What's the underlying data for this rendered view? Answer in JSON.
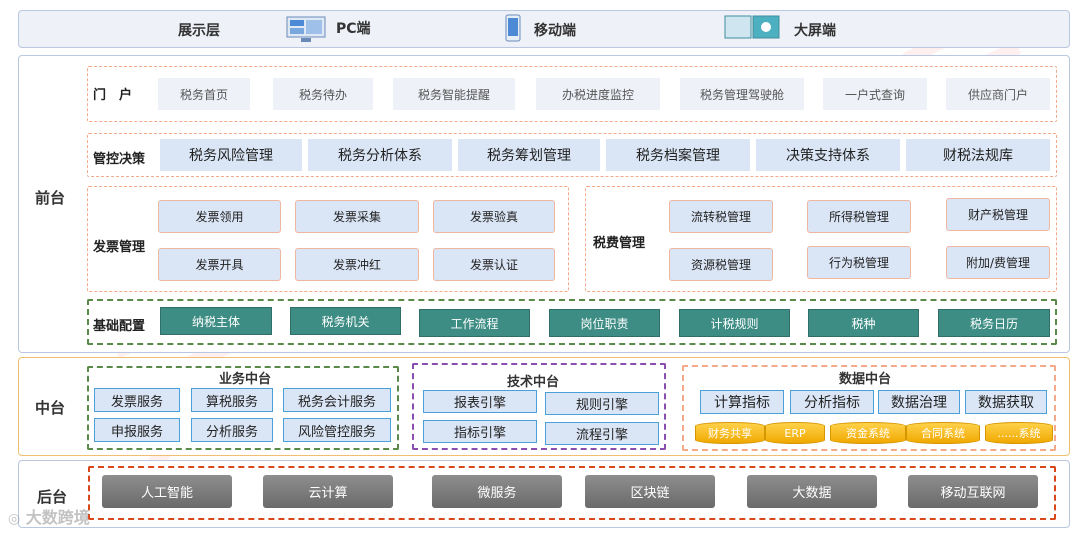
{
  "display_layer": {
    "label": "展示层",
    "items": [
      {
        "label": "PC端",
        "icon": "monitor-icon"
      },
      {
        "label": "移动端",
        "icon": "mobile-phone-icon"
      },
      {
        "label": "大屏端",
        "icon": "large-screen-icon"
      }
    ]
  },
  "front": {
    "label": "前台",
    "portal": {
      "label": "门　户",
      "items": [
        "税务首页",
        "税务待办",
        "税务智能提醒",
        "办税进度监控",
        "税务管理驾驶舱",
        "一户式查询",
        "供应商门户"
      ]
    },
    "control": {
      "label": "管控决策",
      "items": [
        "税务风险管理",
        "税务分析体系",
        "税务筹划管理",
        "税务档案管理",
        "决策支持体系",
        "财税法规库"
      ]
    },
    "invoice": {
      "label": "发票管理",
      "items": [
        "发票领用",
        "发票采集",
        "发票验真",
        "发票开具",
        "发票冲红",
        "发票认证"
      ]
    },
    "tax_fee": {
      "label": "税费管理",
      "items": [
        "流转税管理",
        "所得税管理",
        "财产税管理",
        "资源税管理",
        "行为税管理",
        "附加/费管理"
      ]
    },
    "base": {
      "label": "基础配置",
      "items": [
        "纳税主体",
        "税务机关",
        "工作流程",
        "岗位职责",
        "计税规则",
        "税种",
        "税务日历"
      ]
    }
  },
  "middle": {
    "label": "中台",
    "business": {
      "title": "业务中台",
      "items": [
        "发票服务",
        "算税服务",
        "税务会计服务",
        "申报服务",
        "分析服务",
        "风险管控服务"
      ]
    },
    "tech": {
      "title": "技术中台",
      "items": [
        "报表引擎",
        "规则引擎",
        "指标引擎",
        "流程引擎"
      ]
    },
    "data": {
      "title": "数据中台",
      "items": [
        "计算指标",
        "分析指标",
        "数据治理",
        "数据获取"
      ],
      "sources": [
        "财务共享",
        "ERP",
        "资金系统",
        "合同系统",
        "......系统"
      ]
    }
  },
  "back": {
    "label": "后台",
    "items": [
      "人工智能",
      "云计算",
      "微服务",
      "区块链",
      "大数据",
      "移动互联网"
    ]
  },
  "watermark": {
    "text": "元年",
    "sub": "Yuanian",
    "source": "大数跨境"
  },
  "colors": {
    "teal": "#3e8d84",
    "blue_box": "#dae5f5",
    "gold": "#f0a800",
    "orange_dash": "#d9481b",
    "green_dash": "#5a8a4a",
    "purple_dash": "#8a4db0"
  }
}
